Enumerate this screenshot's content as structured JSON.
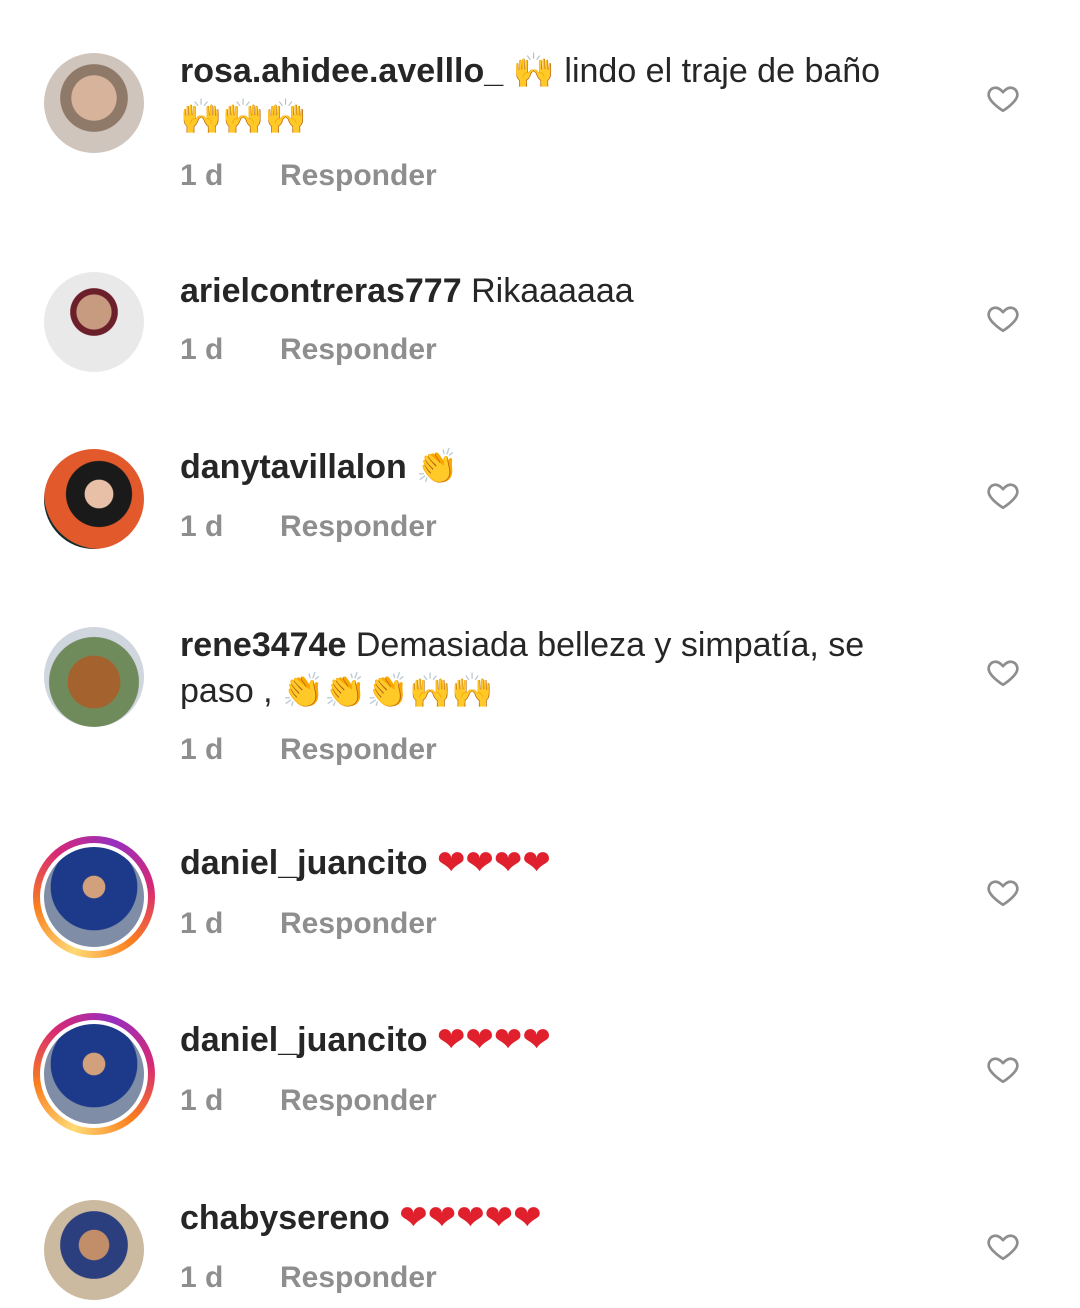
{
  "comments": [
    {
      "username": "rosa.ahidee.avelllo_",
      "text": " 🙌 lindo el traje  de baño 🙌🙌🙌",
      "time": "1 d",
      "reply_label": "Responder"
    },
    {
      "username": "arielcontreras777",
      "text": " Rikaaaaaa",
      "time": "1 d",
      "reply_label": "Responder"
    },
    {
      "username": "danytavillalon",
      "text": " 👏",
      "time": "1 d",
      "reply_label": "Responder"
    },
    {
      "username": "rene3474e",
      "text": " Demasiada belleza y simpatía, se paso , 👏👏👏🙌🙌",
      "time": "1 d",
      "reply_label": "Responder"
    },
    {
      "username": "daniel_juancito",
      "text": " ❤❤❤❤",
      "time": "1 d",
      "reply_label": "Responder"
    },
    {
      "username": "daniel_juancito",
      "text": " ❤❤❤❤",
      "time": "1 d",
      "reply_label": "Responder"
    },
    {
      "username": "chabysereno",
      "text": " ❤❤❤❤❤",
      "time": "1 d",
      "reply_label": "Responder"
    }
  ],
  "icons": {
    "like": "heart-outline-icon"
  },
  "colors": {
    "text": "#262626",
    "meta": "#8e8e8e",
    "heart_icon": "#8e8e8e"
  }
}
